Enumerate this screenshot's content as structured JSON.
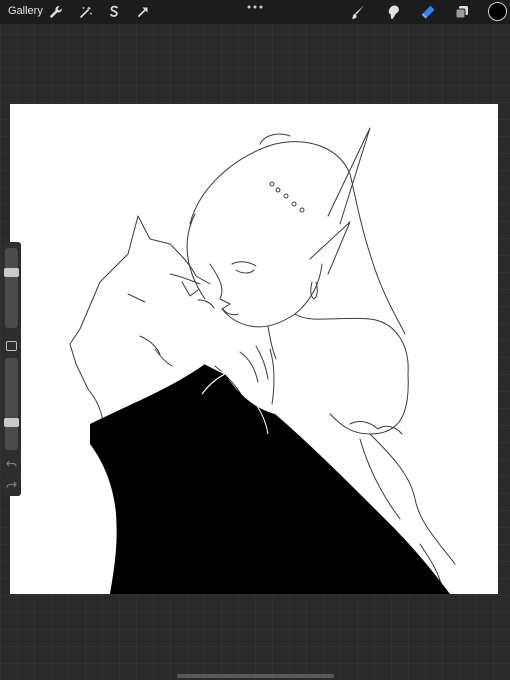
{
  "topbar": {
    "gallery_label": "Gallery",
    "tools_left": [
      "wrench-icon",
      "magic-wand-icon",
      "selection-s-icon",
      "transform-arrow-icon"
    ],
    "tools_right": [
      "brush-icon",
      "smudge-icon",
      "eraser-icon",
      "layers-icon"
    ],
    "active_tool": "eraser-icon",
    "active_tool_color": "#3b82f6",
    "current_color": "#000000"
  },
  "sidebar": {
    "brush_size_level": 0.72,
    "opacity_level": 0.28
  },
  "canvas": {
    "background_color": "#ffffff",
    "ink_color": "#000000"
  }
}
